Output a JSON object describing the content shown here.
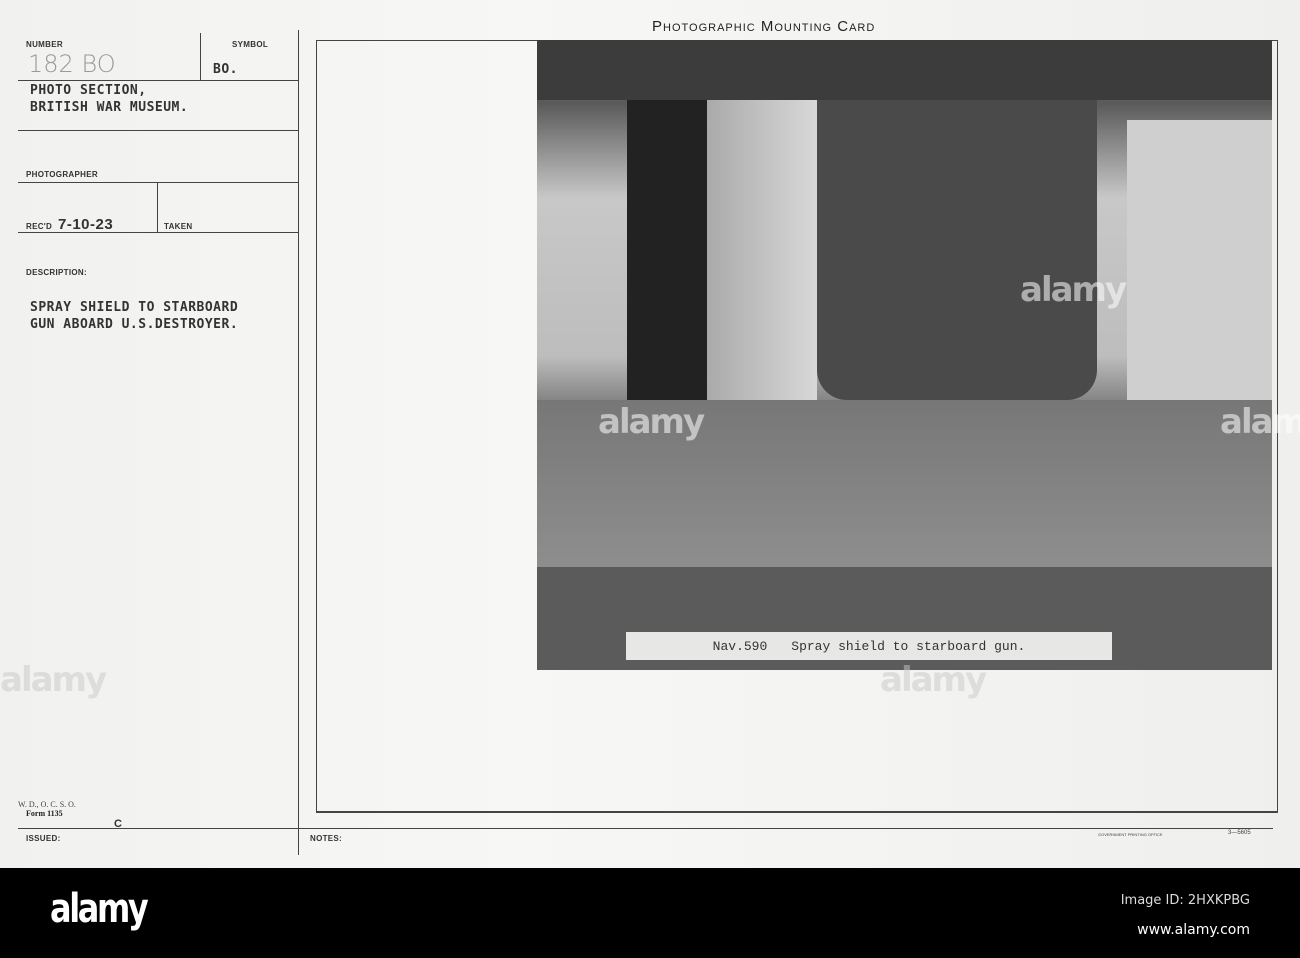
{
  "card": {
    "title": "Photographic Mounting Card",
    "number_label": "NUMBER",
    "number_value": "182 BO",
    "symbol_label": "SYMBOL",
    "symbol_value": "BO.",
    "source_line1": "PHOTO SECTION,",
    "source_line2": "BRITISH WAR MUSEUM.",
    "photographer_label": "PHOTOGRAPHER",
    "recd_label": "REC'D",
    "recd_value": "7-10-23",
    "taken_label": "TAKEN",
    "description_label": "DESCRIPTION:",
    "description_line1": "SPRAY SHIELD TO STARBOARD",
    "description_line2": "GUN ABOARD U.S.DESTROYER.",
    "form_line1": "W. D., O. C. S. O.",
    "form_line2": "Form 1135",
    "issued_label": "ISSUED:",
    "issued_value": "C",
    "notes_label": "NOTES:",
    "printer": "GOVERNMENT PRINTING OFFICE",
    "printer_code": "3—5605"
  },
  "photo": {
    "caption_number": "Nav.590",
    "caption_text": "Spray shield to starboard gun."
  },
  "watermark": {
    "text": "alamy"
  },
  "footer": {
    "logo": "alamy",
    "image_id": "Image ID: 2HXKPBG",
    "url": "www.alamy.com"
  }
}
